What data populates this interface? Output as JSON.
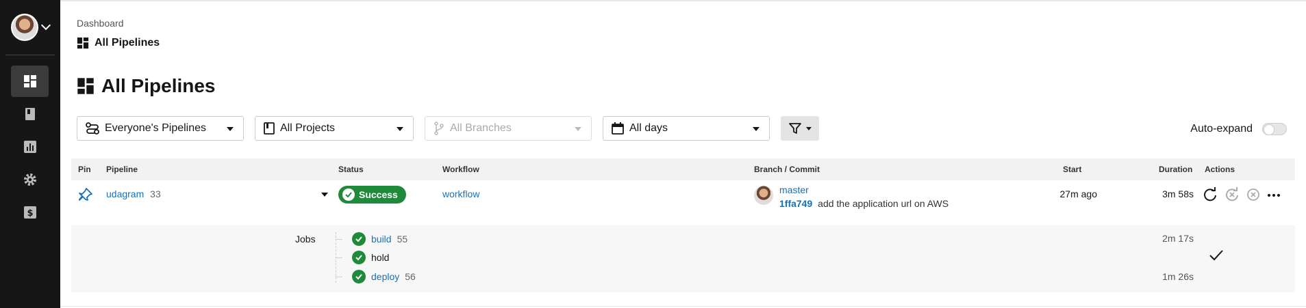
{
  "sidebar": {
    "items": [
      {
        "icon": "dashboard-icon",
        "active": true
      },
      {
        "icon": "book-icon",
        "active": false
      },
      {
        "icon": "insights-chart-icon",
        "active": false
      },
      {
        "icon": "settings-gear-icon",
        "active": false
      },
      {
        "icon": "billing-dollar-icon",
        "active": false
      }
    ]
  },
  "breadcrumb": {
    "parent": "Dashboard",
    "current": "All Pipelines"
  },
  "page_title": "All Pipelines",
  "filters": {
    "pipelines": "Everyone's Pipelines",
    "projects": "All Projects",
    "branches": "All Branches",
    "days": "All days"
  },
  "auto_expand_label": "Auto-expand",
  "auto_expand_on": false,
  "table": {
    "headers": {
      "pin": "Pin",
      "pipeline": "Pipeline",
      "status": "Status",
      "workflow": "Workflow",
      "branch_commit": "Branch / Commit",
      "start": "Start",
      "duration": "Duration",
      "actions": "Actions"
    },
    "row": {
      "pipeline_name": "udagram",
      "pipeline_number": "33",
      "status": "Success",
      "workflow": "workflow",
      "branch": "master",
      "commit_hash": "1ffa749",
      "commit_message": "add the application url on AWS",
      "start": "27m ago",
      "duration": "3m 58s"
    },
    "jobs": {
      "label": "Jobs",
      "items": [
        {
          "name": "build",
          "number": "55"
        },
        {
          "name": "hold",
          "number": ""
        },
        {
          "name": "deploy",
          "number": "56"
        }
      ],
      "durations": {
        "build": "2m 17s",
        "deploy": "1m 26s"
      }
    }
  },
  "colors": {
    "success": "#1f8a3a",
    "link": "#1a6fb5",
    "sidebar": "#161616"
  }
}
